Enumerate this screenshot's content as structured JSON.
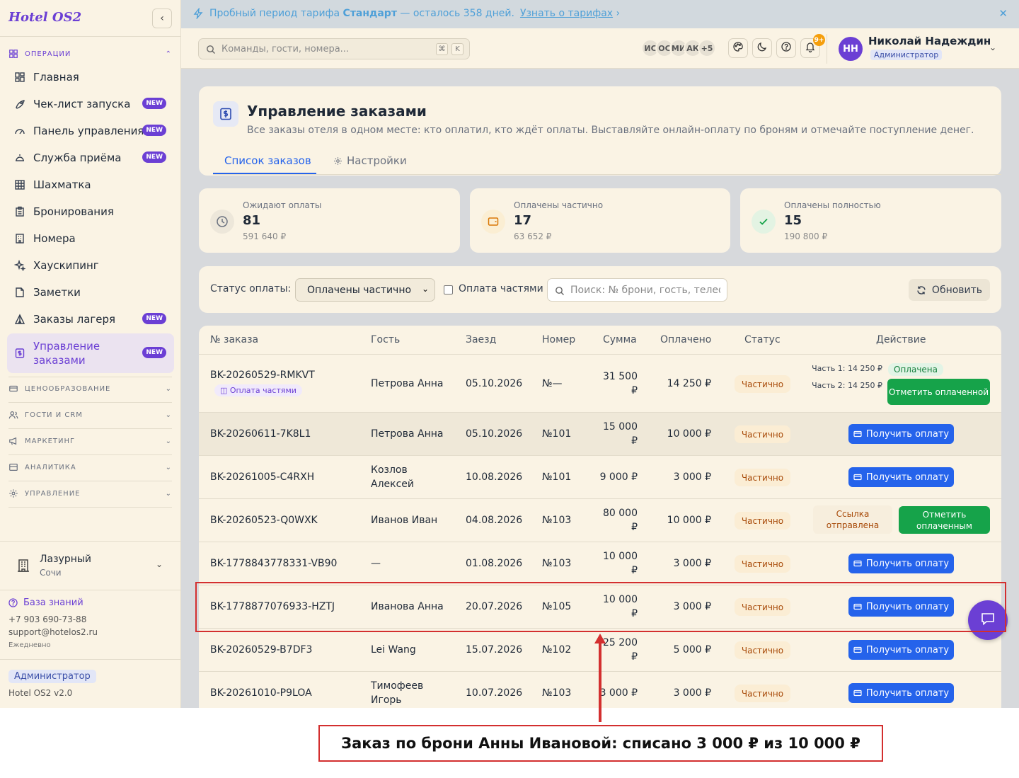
{
  "sidebar": {
    "brand": "Hotel OS2",
    "collapse_icon": "chevron-left-icon",
    "operations_section": "ОПЕРАЦИИ",
    "items": [
      {
        "label": "Главная",
        "icon": "dashboard-grid-icon"
      },
      {
        "label": "Чек-лист запуска",
        "icon": "rocket-icon",
        "badge": "NEW"
      },
      {
        "label": "Панель управления",
        "icon": "gauge-icon",
        "badge": "NEW"
      },
      {
        "label": "Служба приёма",
        "icon": "concierge-bell-icon",
        "badge": "NEW"
      },
      {
        "label": "Шахматка",
        "icon": "grid-icon"
      },
      {
        "label": "Бронирования",
        "icon": "clipboard-icon"
      },
      {
        "label": "Номера",
        "icon": "building-icon"
      },
      {
        "label": "Хаускипинг",
        "icon": "sparkles-icon"
      },
      {
        "label": "Заметки",
        "icon": "note-icon"
      },
      {
        "label": "Заказы лагеря",
        "icon": "tent-icon",
        "badge": "NEW"
      },
      {
        "label": "Управление заказами",
        "icon": "dollar-doc-icon",
        "badge": "NEW",
        "active": true
      }
    ],
    "sections": [
      {
        "label": "ЦЕНООБРАЗОВАНИЕ",
        "icon": "card-icon"
      },
      {
        "label": "ГОСТИ И CRM",
        "icon": "users-icon"
      },
      {
        "label": "МАРКЕТИНГ",
        "icon": "megaphone-icon"
      },
      {
        "label": "АНАЛИТИКА",
        "icon": "chart-icon"
      },
      {
        "label": "УПРАВЛЕНИЕ",
        "icon": "gear-icon"
      }
    ],
    "hotel": {
      "name": "Лазурный",
      "city": "Сочи"
    },
    "knowledge_base": "База знаний",
    "phone": "+7 903 690-73-88",
    "support_email": "support@hotelos2.ru",
    "hours": "Ежедневно",
    "role": "Администратор",
    "version": "Hotel OS2 v2.0"
  },
  "banner": {
    "text_before": "Пробный период тарифа ",
    "plan": "Стандарт",
    "text_after": " — осталось 358 дней.",
    "link": "Узнать о тарифах",
    "link_chevron": "›",
    "close": "✕"
  },
  "topbar": {
    "search_placeholder": "Команды, гости, номера...",
    "kbd_cmd": "⌘",
    "kbd_k": "K",
    "avatars": [
      "ИС",
      "ОС",
      "МИ",
      "АК",
      "+5"
    ],
    "bell_count": "9+",
    "user_initials": "НН",
    "user_name": "Николай Надеждин",
    "user_role": "Администратор"
  },
  "page": {
    "title": "Управление заказами",
    "subtitle": "Все заказы отеля в одном месте: кто оплатил, кто ждёт оплаты. Выставляйте онлайн-оплату по броням и отмечайте поступление денег.",
    "tabs": [
      "Список заказов",
      "Настройки"
    ]
  },
  "stats": [
    {
      "label": "Ожидают оплаты",
      "count": "81",
      "sum": "591 640 ₽",
      "icon": "clock-icon",
      "color": "#6b7280"
    },
    {
      "label": "Оплачены частично",
      "count": "17",
      "sum": "63 652 ₽",
      "icon": "wallet-icon",
      "color": "#d97706"
    },
    {
      "label": "Оплачены полностью",
      "count": "15",
      "sum": "190 800 ₽",
      "icon": "check-icon",
      "color": "#16a34a"
    }
  ],
  "filters": {
    "status_label": "Статус оплаты:",
    "status_value": "Оплачены частично",
    "installments_label": "Оплата частями",
    "search_placeholder": "Поиск: № брони, гость, телефон",
    "refresh": "Обновить"
  },
  "table": {
    "headers": [
      "№ заказа",
      "Гость",
      "Заезд",
      "Номер",
      "Сумма",
      "Оплачено",
      "Статус",
      "Действие"
    ],
    "rows": [
      {
        "order": "BK-20260529-RMKVT",
        "tag": "Оплата частями",
        "guest": "Петрова Анна",
        "checkin": "05.10.2026",
        "room": "№—",
        "sum": "31 500 ₽",
        "paid": "14 250 ₽",
        "status": "Частично",
        "part1": "Часть 1: 14 250 ₽",
        "part1_status": "Оплачена",
        "part2": "Часть 2: 14 250 ₽",
        "action": "Отметить оплаченной"
      },
      {
        "order": "BK-20260611-7K8L1",
        "guest": "Петрова Анна",
        "checkin": "05.10.2026",
        "room": "№101",
        "sum": "15 000 ₽",
        "paid": "10 000 ₽",
        "status": "Частично",
        "action": "Получить оплату"
      },
      {
        "order": "BK-20261005-C4RXH",
        "guest": "Козлов Алексей",
        "checkin": "10.08.2026",
        "room": "№101",
        "sum": "9 000 ₽",
        "paid": "3 000 ₽",
        "status": "Частично",
        "action": "Получить оплату"
      },
      {
        "order": "BK-20260523-Q0WXK",
        "guest": "Иванов Иван",
        "checkin": "04.08.2026",
        "room": "№103",
        "sum": "80 000 ₽",
        "paid": "10 000 ₽",
        "status": "Частично",
        "link_sent": "Ссылка отправлена",
        "action": "Отметить оплаченным"
      },
      {
        "order": "BK-1778843778331-VB90",
        "guest": "—",
        "checkin": "01.08.2026",
        "room": "№103",
        "sum": "10 000 ₽",
        "paid": "3 000 ₽",
        "status": "Частично",
        "action": "Получить оплату"
      },
      {
        "order": "BK-1778877076933-HZTJ",
        "guest": "Иванова Анна",
        "checkin": "20.07.2026",
        "room": "№105",
        "sum": "10 000 ₽",
        "paid": "3 000 ₽",
        "status": "Частично",
        "action": "Получить оплату"
      },
      {
        "order": "BK-20260529-B7DF3",
        "guest": "Lei Wang",
        "checkin": "15.07.2026",
        "room": "№102",
        "sum": "25 200 ₽",
        "paid": "5 000 ₽",
        "status": "Частично",
        "action": "Получить оплату"
      },
      {
        "order": "BK-20261010-P9LOA",
        "guest": "Тимофеев Игорь",
        "checkin": "10.07.2026",
        "room": "№103",
        "sum": "3 000 ₽",
        "paid": "3 000 ₽",
        "status": "Частично",
        "action": "Получить оплату"
      }
    ]
  },
  "annotation": {
    "caption": "Заказ по брони Анны Ивановой: списано 3 000 ₽ из 10 000 ₽",
    "color": "#d32f2f"
  },
  "colors": {
    "accent": "#6b3fd4",
    "primary": "#2563eb",
    "success": "#16a34a",
    "warning": "#a84b0a"
  }
}
